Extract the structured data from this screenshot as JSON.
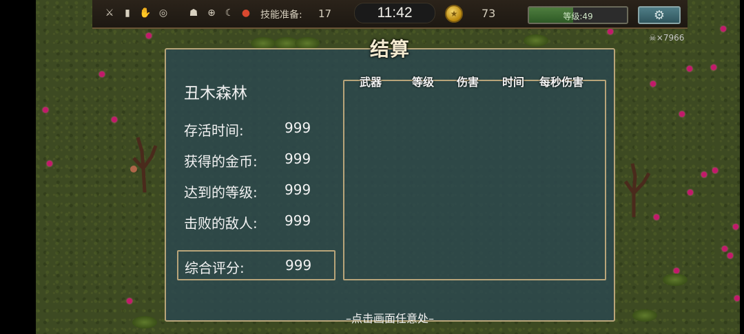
{
  "hud": {
    "skill_label": "技能准备:",
    "skill_value": "17",
    "timer": "11:42",
    "coins": "73",
    "level_label": "等级:49",
    "level_progress": 0.45
  },
  "kill_counter": "×7966",
  "panel": {
    "title": "结算",
    "stage_name": "丑木森林",
    "stats": [
      {
        "label": "存活时间:",
        "value": "999"
      },
      {
        "label": "获得的金币:",
        "value": "999"
      },
      {
        "label": "达到的等级:",
        "value": "999"
      },
      {
        "label": "击败的敌人:",
        "value": "999"
      }
    ],
    "score": {
      "label": "综合评分:",
      "value": "999"
    },
    "table_headers": [
      "武器",
      "等级",
      "伤害",
      "时间",
      "每秒伤害"
    ],
    "hint": "–点击画面任意处–"
  },
  "icons": [
    "sword-icon",
    "coffin-icon",
    "claw-icon",
    "ring-icon",
    "helmet-icon",
    "compass-icon",
    "horn-icon",
    "apple-icon",
    "coin-icon",
    "gear-icon",
    "skull-icon"
  ],
  "colors": {
    "panel_bg": "#2c484e",
    "panel_border": "#b9a57a",
    "level_fill": "#4e7d3e"
  }
}
